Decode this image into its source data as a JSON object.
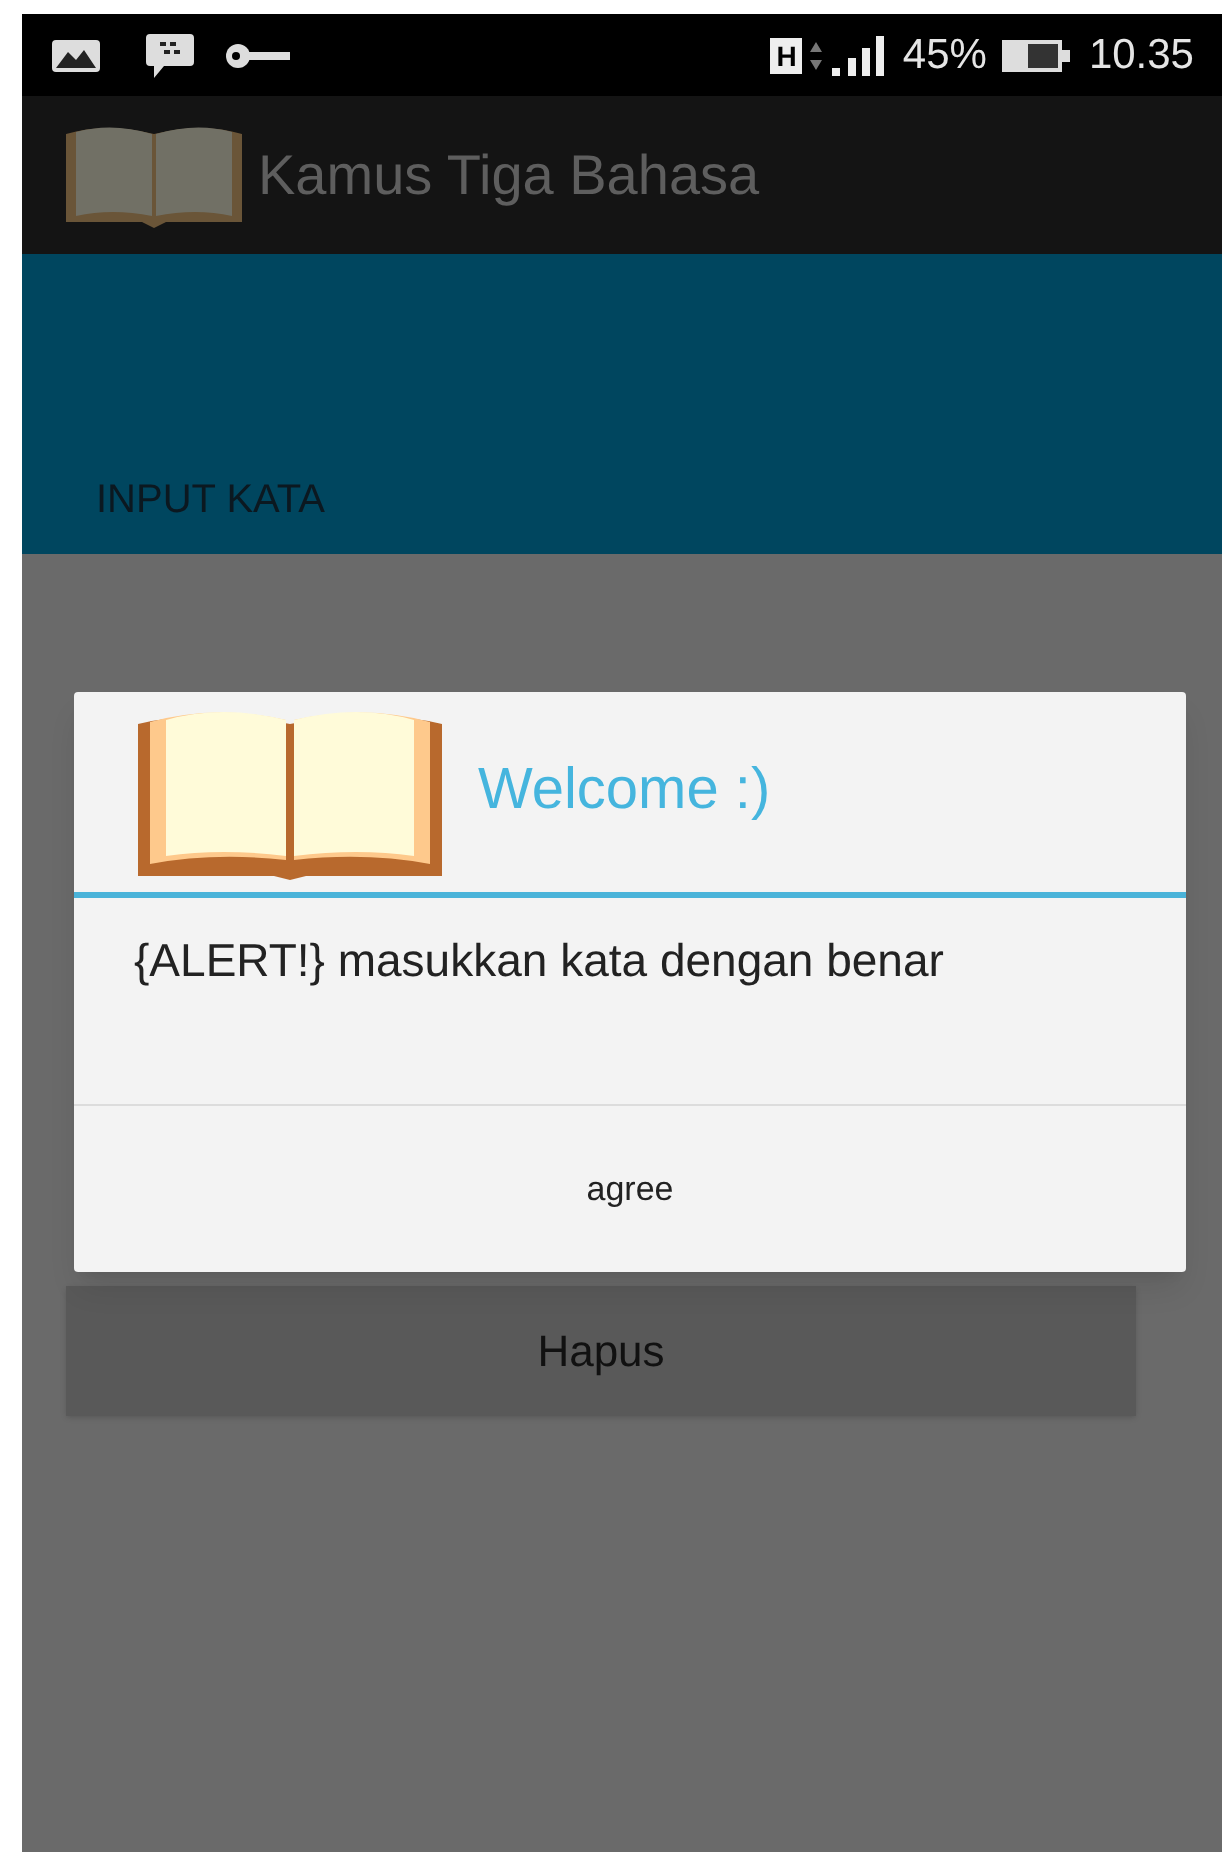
{
  "status_bar": {
    "battery_percent": "45%",
    "time": "10.35",
    "network": "H"
  },
  "app_bar": {
    "title": "Kamus Tiga Bahasa"
  },
  "header": {
    "label": "INPUT KATA"
  },
  "buttons": [
    "Hapus"
  ],
  "dialog": {
    "title": "Welcome :)",
    "message": "{ALERT!} masukkan kata dengan benar",
    "button": "agree"
  }
}
